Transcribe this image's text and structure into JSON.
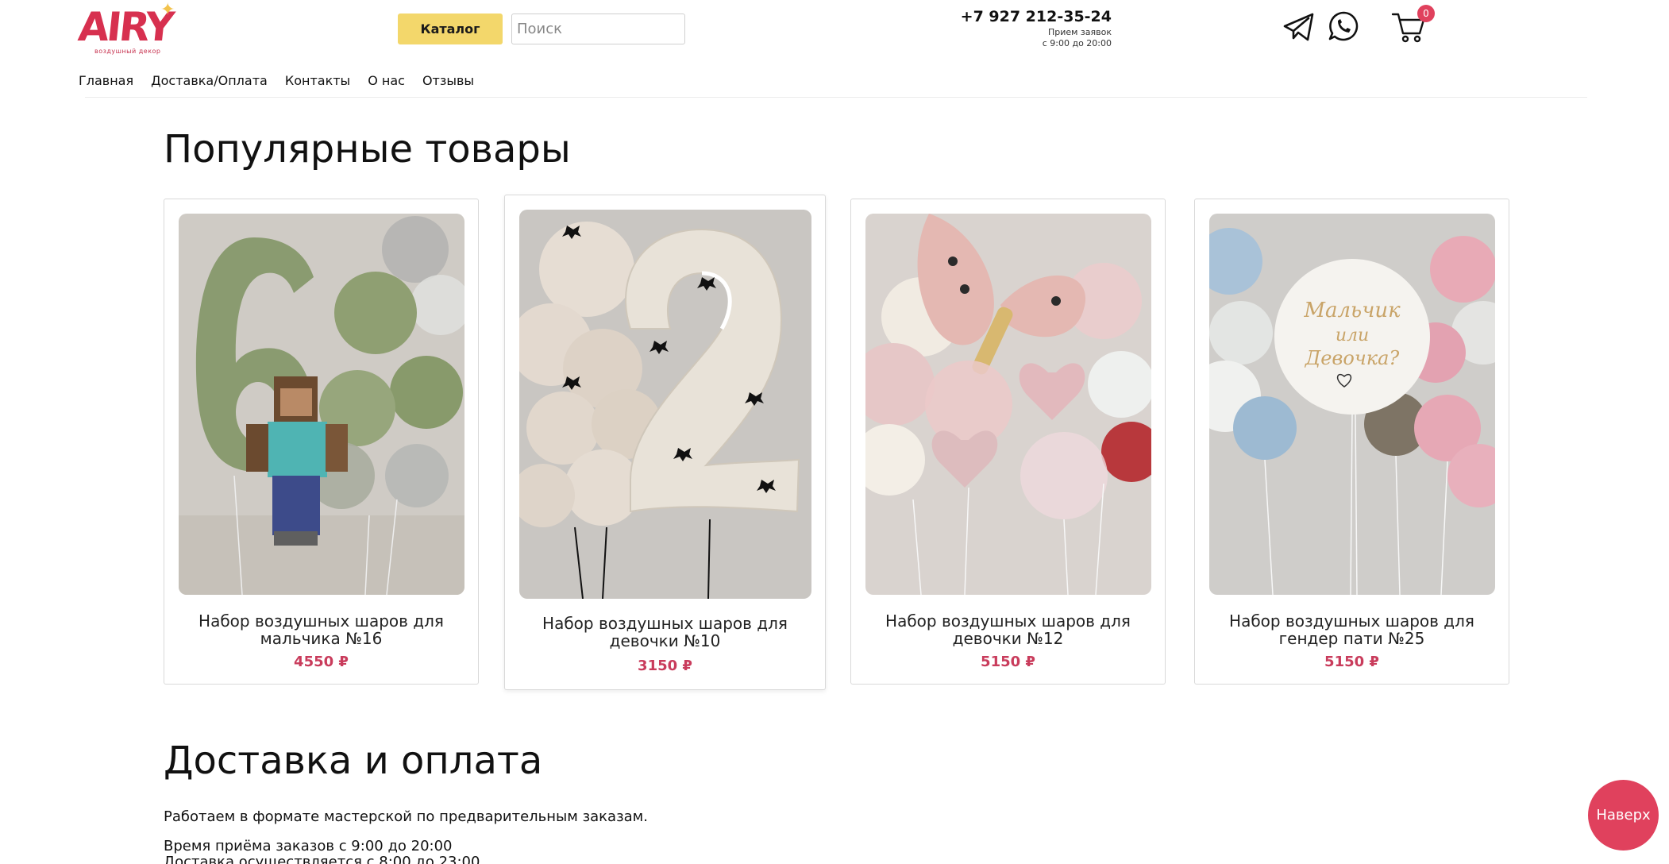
{
  "header": {
    "logo_text": "AIRY",
    "logo_tagline": "воздушный декор",
    "catalog_label": "Каталог",
    "search_placeholder": "Поиск",
    "phone": "+7 927 212-35-24",
    "hours_label": "Прием заявок",
    "hours": "с 9:00 до 20:00",
    "cart_count": "0",
    "icons": [
      "telegram-icon",
      "whatsapp-icon",
      "cart-icon"
    ]
  },
  "nav": [
    {
      "label": "Главная"
    },
    {
      "label": "Доставка/Оплата"
    },
    {
      "label": "Контакты"
    },
    {
      "label": "О нас"
    },
    {
      "label": "Отзывы"
    }
  ],
  "popular": {
    "title": "Популярные товары",
    "products": [
      {
        "name": "Набор воздушных шаров для мальчика №16",
        "price": "4550 ₽"
      },
      {
        "name": "Набор воздушных шаров для девочки №10",
        "price": "3150 ₽"
      },
      {
        "name": "Набор воздушных шаров для девочки №12",
        "price": "5150 ₽"
      },
      {
        "name": "Набор воздушных шаров для гендер пати №25",
        "price": "5150 ₽"
      }
    ]
  },
  "delivery": {
    "title": "Доставка и оплата",
    "line1": "Работаем в формате мастерской по предварительным заказам.",
    "line2": "Время приёма заказов с 9:00 до 20:00",
    "line3": "Доставка осуществляется с 8:00 до 23:00"
  },
  "to_top_label": "Наверх",
  "colors": {
    "brand": "#d7304f",
    "catalog_button": "#f3d76b",
    "price": "#c93c5c",
    "to_top": "#e0415d"
  }
}
